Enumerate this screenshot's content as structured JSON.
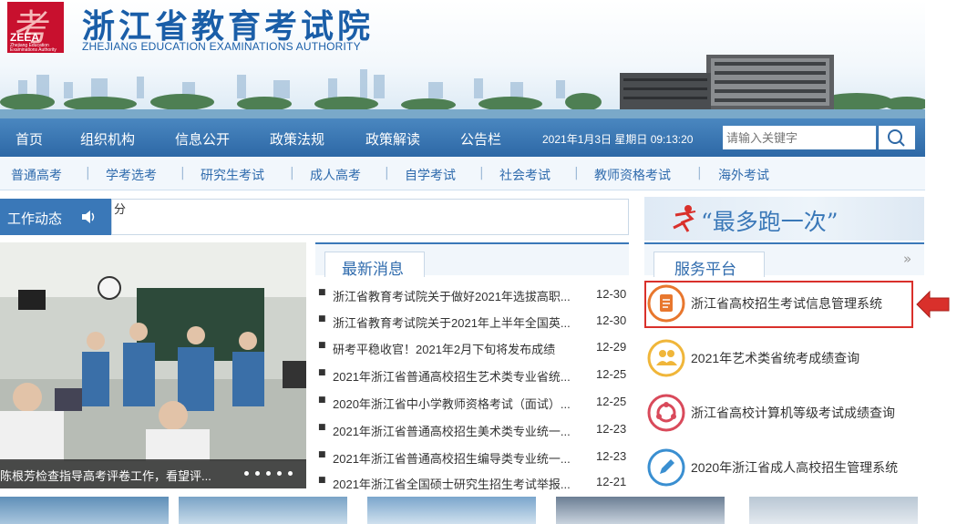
{
  "header": {
    "logo_glyph": "考",
    "logo_abbr": "ZEEA",
    "logo_small": "Zhejiang Education Examinations Authority",
    "title": "浙江省教育考试院",
    "subtitle": "ZHEJIANG EDUCATION EXAMINATIONS AUTHORITY"
  },
  "nav": {
    "items": [
      "首页",
      "组织机构",
      "信息公开",
      "政策法规",
      "政策解读",
      "公告栏"
    ],
    "date": "2021年1月3日 星期日 09:13:20",
    "search_placeholder": "请输入关键字"
  },
  "subnav": {
    "items": [
      "普通高考",
      "学考选考",
      "研究生考试",
      "成人高考",
      "自学考试",
      "社会考试",
      "教师资格考试",
      "海外考试"
    ]
  },
  "work": {
    "tab_label": "工作动态",
    "ticker": "分"
  },
  "photo": {
    "caption": "陈根芳检查指导高考评卷工作，看望评..."
  },
  "news": {
    "tab_label": "最新消息",
    "items": [
      {
        "title": "浙江省教育考试院关于做好2021年选拔高职...",
        "date": "12-30"
      },
      {
        "title": "浙江省教育考试院关于2021年上半年全国英...",
        "date": "12-30"
      },
      {
        "title": "研考平稳收官！2021年2月下旬将发布成绩",
        "date": "12-29"
      },
      {
        "title": "2021年浙江省普通高校招生艺术类专业省统...",
        "date": "12-25"
      },
      {
        "title": "2020年浙江省中小学教师资格考试（面试）...",
        "date": "12-25"
      },
      {
        "title": "2021年浙江省普通高校招生美术类专业统一...",
        "date": "12-23"
      },
      {
        "title": "2021年浙江省普通高校招生编导类专业统一...",
        "date": "12-23"
      },
      {
        "title": "2021年浙江省全国硕士研究生招生考试举报...",
        "date": "12-21"
      }
    ]
  },
  "banner": {
    "text": "“最多跑一次”"
  },
  "service": {
    "tab_label": "服务平台",
    "more": "»",
    "items": [
      {
        "label": "浙江省高校招生考试信息管理系统",
        "icon": "document-icon",
        "color": "#e8772e"
      },
      {
        "label": "2021年艺术类省统考成绩查询",
        "icon": "users-icon",
        "color": "#f0b63a"
      },
      {
        "label": "浙江省高校计算机等级考试成绩查询",
        "icon": "cycle-icon",
        "color": "#d94a5b"
      },
      {
        "label": "2020年浙江省成人高校招生管理系统",
        "icon": "pen-icon",
        "color": "#3a8fd1"
      }
    ]
  },
  "colors": {
    "nav_blue": "#2d68a6",
    "title_blue": "#1a5ea8",
    "highlight_red": "#d9302b"
  }
}
